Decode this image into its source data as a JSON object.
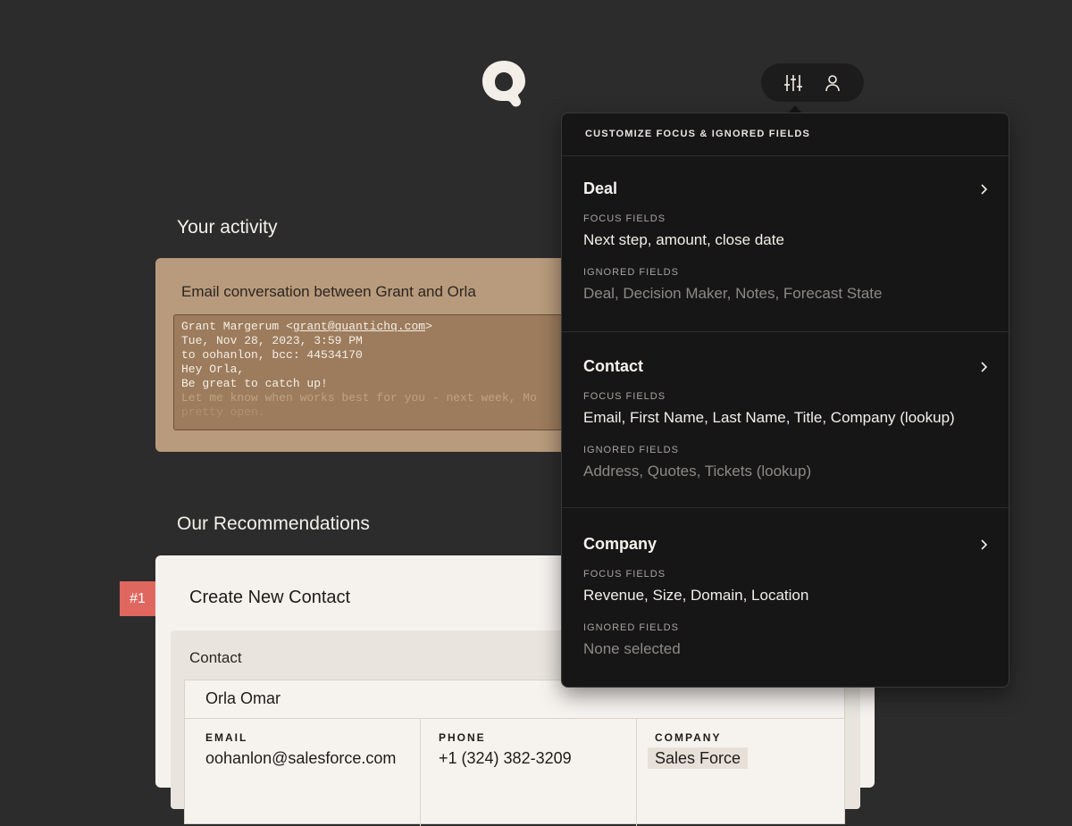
{
  "toolbar": {
    "filter_icon": "sliders-icon",
    "user_icon": "user-icon"
  },
  "activity": {
    "section_title": "Your activity",
    "card_title": "Email conversation between Grant and Orla",
    "email": {
      "from_name": "Grant Margerum <",
      "from_email": "grant@quantichq.com",
      "from_close": ">",
      "date": "Tue, Nov 28, 2023, 3:59 PM",
      "to": "to oohanlon, bcc: 44534170",
      "greeting": "Hey Orla,",
      "line1": "Be great to catch up!",
      "line2": "Let me know when works best for you - next week, Mo",
      "line3": "pretty open."
    }
  },
  "recommendations": {
    "section_title": "Our Recommendations",
    "rank": "#1",
    "card_title": "Create New Contact",
    "panel_label": "Contact",
    "contact_name": "Orla Omar",
    "fields": [
      {
        "label": "EMAIL",
        "value": "oohanlon@salesforce.com"
      },
      {
        "label": "PHONE",
        "value": "+1 (324) 382-3209"
      },
      {
        "label": "COMPANY",
        "value": "Sales Force"
      }
    ]
  },
  "popover": {
    "header": "CUSTOMIZE FOCUS & IGNORED FIELDS",
    "focus_label": "FOCUS FIELDS",
    "ignored_label": "IGNORED FIELDS",
    "sections": [
      {
        "title": "Deal",
        "focus": "Next step, amount, close date",
        "ignored": "Deal, Decision Maker, Notes, Forecast State"
      },
      {
        "title": "Contact",
        "focus": "Email, First Name, Last Name, Title, Company (lookup)",
        "ignored": "Address, Quotes, Tickets (lookup)"
      },
      {
        "title": "Company",
        "focus": "Revenue, Size, Domain, Location",
        "ignored": "None selected"
      }
    ]
  },
  "colors": {
    "background": "#2d2c2d",
    "activity_card": "#b89b7c",
    "rank_badge": "#e0675f",
    "popover": "#171617"
  }
}
